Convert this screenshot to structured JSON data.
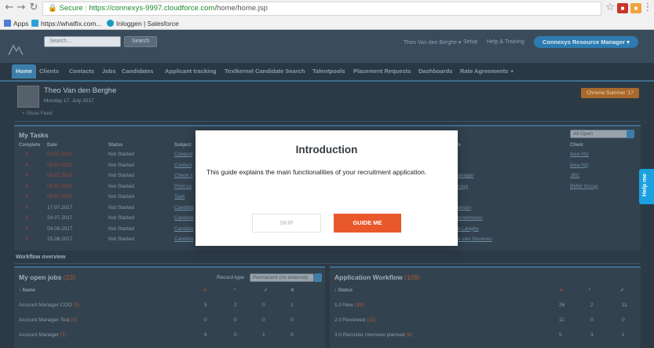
{
  "browser": {
    "secure_label": "Secure",
    "url_host": "https://connexys-9997.cloudforce.com",
    "url_path": "/home/home.jsp",
    "bookmarks": [
      {
        "label": "Apps",
        "color": "#4a7fd1"
      },
      {
        "label": "https://whatfix.com...",
        "color": "#2f9fd9"
      },
      {
        "label": "Inloggen | Salesforce",
        "color": "#1798c1"
      }
    ]
  },
  "header": {
    "search_placeholder": "Search...",
    "search_button": "Search",
    "user_menu": "Theo Van den Berghe ▾",
    "setup": "Setup",
    "help": "Help & Training",
    "app_switcher": "Connexys Resource Manager ▾"
  },
  "tabs": [
    "Home",
    "Clients",
    "Contacts",
    "Jobs",
    "Candidates",
    "Applicant tracking",
    "Textkernel Candidate Search",
    "Talentpools",
    "Placement Requests",
    "Dashboards",
    "Rate Agreements",
    "+"
  ],
  "profile": {
    "name": "Theo Van den Berghe",
    "date": "Monday 17. July 2017",
    "show_feed": "Show Feed",
    "orange_button": "Chrome Summer '17"
  },
  "tasks": {
    "title": "My Tasks",
    "filter": "All Open",
    "columns": [
      "Complete",
      "Date",
      "Status",
      "Subject",
      "To",
      "Client"
    ],
    "rows": [
      {
        "x": "X",
        "date": "03.07.2017",
        "status": "Not Started",
        "subject": "Congrat",
        "to": "",
        "client": "Ikea HQ",
        "overdue": true
      },
      {
        "x": "X",
        "date": "05.07.2017",
        "status": "Not Started",
        "subject": "Contact",
        "to": "s",
        "client": "Ikea HQ",
        "overdue": true
      },
      {
        "x": "X",
        "date": "05.07.2017",
        "status": "Not Started",
        "subject": "Check s",
        "to": "Manager",
        "client": "JBC",
        "overdue": true
      },
      {
        "x": "X",
        "date": "05.07.2017",
        "status": "Not Started",
        "subject": "Print co",
        "to": "Group",
        "client": "BMW Group",
        "overdue": true
      },
      {
        "x": "X",
        "date": "05.07.2017",
        "status": "Not Started",
        "subject": "Task",
        "to": "",
        "client": "",
        "overdue": true
      },
      {
        "x": "X",
        "date": "17.07.2017",
        "status": "Not Started",
        "subject": "Candida",
        "to": "Seeson",
        "client": "",
        "overdue": false
      },
      {
        "x": "X",
        "date": "24.07.2017",
        "status": "Not Started",
        "subject": "Candida",
        "to": "Vervelmeren",
        "client": "",
        "overdue": false
      },
      {
        "x": "X",
        "date": "04.08.2017",
        "status": "Not Started",
        "subject": "Candida",
        "to": "De Langhe",
        "client": "",
        "overdue": false
      },
      {
        "x": "X",
        "date": "25.08.2017",
        "status": "Not Started",
        "subject": "Candida",
        "to": "ole van Stoveren",
        "client": "",
        "overdue": false
      }
    ]
  },
  "workflow_overview": "Workflow overview",
  "open_jobs": {
    "title": "My open jobs",
    "count": "(23)",
    "record_type_label": "Record type",
    "record_type_value": "Permanent (no external)",
    "name_header": "Name",
    "header_marks": [
      "▲",
      "•",
      "✓",
      "✕"
    ],
    "rows": [
      {
        "name": "Account Manager COO",
        "count": "(5)",
        "v": [
          "5",
          "2",
          "0",
          "1"
        ]
      },
      {
        "name": "Account Manager Test",
        "count": "(0)",
        "v": [
          "0",
          "0",
          "0",
          "0"
        ]
      },
      {
        "name": "Account Manager",
        "count": "(7)",
        "v": [
          "6",
          "0",
          "1",
          "0"
        ]
      }
    ]
  },
  "app_workflow": {
    "title": "Application Workflow",
    "count": "(109)",
    "status_header": "Status",
    "header_marks": [
      "▲",
      "•",
      "✓"
    ],
    "rows": [
      {
        "name": "1.0 New",
        "count": "(39)",
        "v": [
          "26",
          "2",
          "11"
        ]
      },
      {
        "name": "2.0 Reviewed",
        "count": "(11)",
        "v": [
          "11",
          "0",
          "0"
        ]
      },
      {
        "name": "3.0 Recruiter interview planned",
        "count": "(8)",
        "v": [
          "5",
          "3",
          "1"
        ]
      }
    ]
  },
  "help_tab": "Help me",
  "modal": {
    "title": "Introduction",
    "text": "This guide explains the main functionalities of your recruitment application.",
    "skip": "SKIP",
    "guide": "GUIDE ME"
  },
  "colors": {
    "accent": "#e8582b",
    "help": "#1ba0e0",
    "tab_active": "#3d7ea9"
  }
}
